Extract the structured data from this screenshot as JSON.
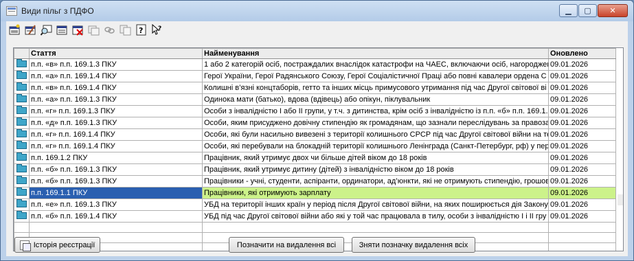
{
  "window": {
    "title": "Види пільг з ПДФО"
  },
  "toolbar": {
    "icons": [
      "add-record-icon",
      "edit-record-icon",
      "find-icon",
      "view-record-icon",
      "delete-record-icon",
      "copy-record-icon",
      "link-icon",
      "copy-icon",
      "help-icon",
      "pointer-help-icon"
    ]
  },
  "table": {
    "columns": [
      "Стаття",
      "Найменування",
      "Оновлено"
    ],
    "rows": [
      {
        "code": "п.п. «в» п.п. 169.1.3 ПКУ",
        "name": "1 або 2 категорій осіб, постраждалих внаслідок катастрофи на ЧАЕС, включаючи осіб, нагороджен",
        "date": "09.01.2026"
      },
      {
        "code": "п.п. «а» п.п. 169.1.4 ПКУ",
        "name": "Герої України, Герої Радянського Союзу, Герої Соціалістичної Праці або повні кавалери ордена С",
        "date": "09.01.2026"
      },
      {
        "code": "п.п. «в» п.п. 169.1.4 ПКУ",
        "name": "Колишні в’язні концтаборів, гетто та інших місць примусового утримання під час Другої світової ві",
        "date": "09.01.2026"
      },
      {
        "code": "п.п. «а» п.п. 169.1.3 ПКУ",
        "name": "Одинока мати (батько), вдова (вдівець) або опікун, піклувальник",
        "date": "09.01.2026"
      },
      {
        "code": "п.п. «г» п.п. 169.1.3 ПКУ",
        "name": "Особи з інвалідністю I або II групи, у т.ч. з дитинства, крім осіб з інвалідністю із п.п. «б» п.п. 169.1.",
        "date": "09.01.2026"
      },
      {
        "code": "п.п. «д» п.п. 169.1.3 ПКУ",
        "name": "Особи, яким присуджено довічну стипендію як громадянам, що зазнали переслідувань за правоза",
        "date": "09.01.2026"
      },
      {
        "code": "п.п. «г» п.п. 169.1.4 ПКУ",
        "name": "Особи, які були насильно вивезені з території колишнього СРСР під час Другої світової війни на те",
        "date": "09.01.2026"
      },
      {
        "code": "п.п. «г» п.п. 169.1.4 ПКУ",
        "name": "Особи, які перебували на блокадній території колишнього Ленінграда (Санкт-Петербург, рф) у пер",
        "date": "09.01.2026"
      },
      {
        "code": "п.п. 169.1.2 ПКУ",
        "name": "Працівник, який утримує двох чи більше дітей віком до 18 років",
        "date": "09.01.2026"
      },
      {
        "code": "п.п. «б» п.п. 169.1.3 ПКУ",
        "name": "Працівник, який утримує дитину (дітей) з інвалідністю віком до 18 років",
        "date": "09.01.2026"
      },
      {
        "code": "п.п. «б» п.п. 169.1.3 ПКУ",
        "name": "Працівники - учні, студенти, аспіранти, ординатори, ад’юнкти, які не отримують стипендію, грошов",
        "date": "09.01.2026"
      },
      {
        "code": "п.п. 169.1.1 ПКУ",
        "name": "Працівники, які отримують зарплату",
        "date": "09.01.2026",
        "selected": true
      },
      {
        "code": "п.п. «е» п.п. 169.1.3 ПКУ",
        "name": "УБД на території інших країн у період після Другої світової війни, на яких поширюється дія Закону",
        "date": "09.01.2026"
      },
      {
        "code": "п.п. «б» п.п. 169.1.4 ПКУ",
        "name": "УБД під час Другої світової війни або які у той час працювала в тилу, особи з інвалідністю I і II гру",
        "date": "09.01.2026"
      }
    ],
    "empty_rows": 4
  },
  "buttons": {
    "history": "Історія реєстрації",
    "mark_all": "Позначити на видалення всі",
    "unmark_all": "Зняти позначку видалення всіх"
  }
}
